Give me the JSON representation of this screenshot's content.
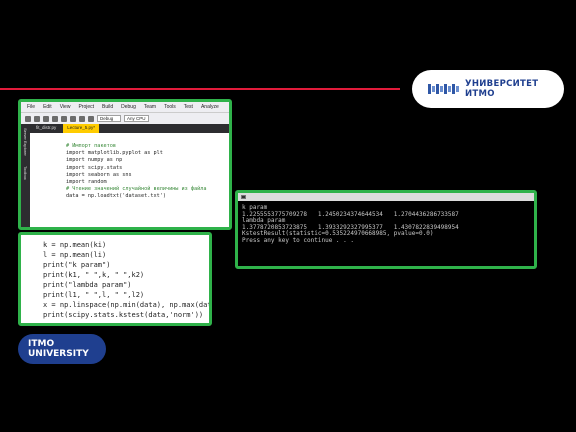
{
  "header": {
    "university_logo_text": "УНИВЕРСИТЕТ ИТМО"
  },
  "ide": {
    "menu": [
      "File",
      "Edit",
      "View",
      "Project",
      "Build",
      "Debug",
      "Team",
      "Tools",
      "Test",
      "Analyze"
    ],
    "config_select": "Debug",
    "platform_select": "Any CPU",
    "side_panels": [
      "Server Explorer",
      "Toolbox"
    ],
    "tabs": [
      "fit_distr.py",
      "Lecture_5.py*"
    ],
    "code": [
      "# Импорт пакетов",
      "import matplotlib.pyplot as plt",
      "import numpy as np",
      "import scipy.stats",
      "import seaborn as sns",
      "import random",
      "",
      "# Чтение значений случайной величины из файла",
      "data = np.loadtxt('dataset.txt')"
    ]
  },
  "console": {
    "lines": [
      "k param",
      "1.2255553775709278   1.2450234374644534   1.2704436286733587",
      "lambda param",
      "1.3778720853723875   1.3933292327995377   1.4307822839498954",
      "KstestResult(statistic=0.535224970668985, pvalue=0.0)",
      "Press any key to continue . . ."
    ]
  },
  "snippet": {
    "lines": [
      "k = np.mean(ki)",
      "l = np.mean(li)",
      "print(\"k param\")",
      "print(k1, \" \",k, \" \",k2)",
      "print(\"lambda param\")",
      "print(l1, \" \",l, \" \",l2)",
      "",
      "x = np.linspace(np.min(data), np.max(data))",
      "print(scipy.stats.kstest(data,'norm'))"
    ]
  },
  "badge": {
    "line1": "ITMO",
    "line2": "UNIVERSITY"
  },
  "colors": {
    "accent_red": "#e21b3b",
    "frame_green": "#2fb24a",
    "brand_blue": "#1f3f8f"
  }
}
